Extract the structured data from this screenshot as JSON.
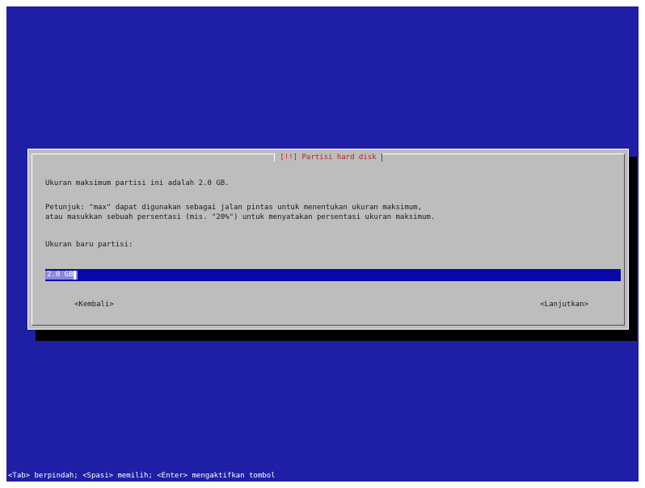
{
  "dialog": {
    "title": "[!!] Partisi hard disk",
    "max_size_text": "Ukuran maksimum partisi ini adalah 2.0 GB.",
    "hint_line1": "Petunjuk: \"max\" dapat digunakan sebagai jalan pintas untuk menentukan ukuran maksimum,",
    "hint_line2": "atau masukkan sebuah persentasi (mis. \"20%\") untuk menyatakan persentasi ukuran maksimum.",
    "new_size_label": "Ukuran baru partisi:",
    "input_value": "2.0 GB",
    "back_button": "<Kembali>",
    "continue_button": "<Lanjutkan>"
  },
  "status_bar": {
    "text": "<Tab> berpindah; <Spasi> memilih; <Enter> mengaktifkan tombol"
  },
  "colors": {
    "background": "#1f1fa6",
    "dialog": "#bdbdbd",
    "title": "#c01c1c",
    "input": "#0808a8"
  }
}
